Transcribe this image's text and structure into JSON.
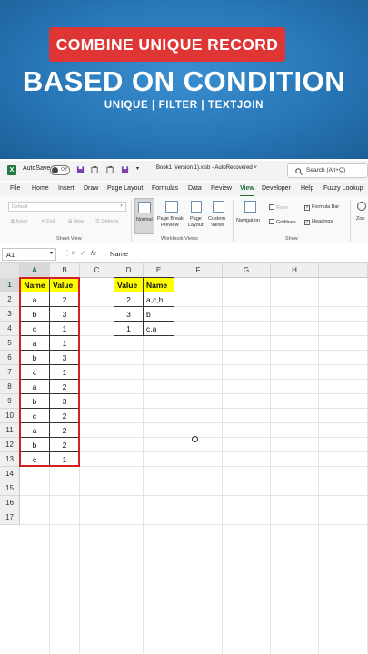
{
  "banner": {
    "pill_text": "COMBINE UNIQUE RECORD",
    "title": "BASED ON CONDITION",
    "subtitle": "UNIQUE | FILTER | TEXTJOIN",
    "colors": {
      "pill": "#e03535",
      "background": "#2877b8"
    }
  },
  "titlebar": {
    "autosave_label": "AutoSave",
    "autosave_state": "Off",
    "filename": "Book1 (version 1).xlsb  -  AutoRecovered",
    "chevron": "˅",
    "search_placeholder": "Search (Alt+Q)"
  },
  "tabs": [
    "File",
    "Home",
    "Insert",
    "Draw",
    "Page Layout",
    "Formulas",
    "Data",
    "Review",
    "View",
    "Developer",
    "Help",
    "Fuzzy Lookup"
  ],
  "active_tab": "View",
  "ribbon": {
    "sheet_view": {
      "dropdown": "Default",
      "keep": "Keep",
      "exit": "Exit",
      "new": "New",
      "options": "Options",
      "label": "Sheet View"
    },
    "workbook_views": {
      "normal": "Normal",
      "page_break_1": "Page Break",
      "page_break_2": "Preview",
      "page_layout_1": "Page",
      "page_layout_2": "Layout",
      "custom_1": "Custom",
      "custom_2": "Views",
      "label": "Workbook Views"
    },
    "show": {
      "navigation": "Navigation",
      "ruler": "Ruler",
      "gridlines": "Gridlines",
      "formula_bar": "Formula Bar",
      "headings": "Headings",
      "label": "Show"
    },
    "zoom_partial": "Zoo"
  },
  "formula_bar": {
    "name_box": "A1",
    "fx": "fx",
    "content": "Name"
  },
  "columns": [
    "A",
    "B",
    "C",
    "D",
    "E",
    "F",
    "G",
    "H",
    "I"
  ],
  "rows": [
    "1",
    "2",
    "3",
    "4",
    "5",
    "6",
    "7",
    "8",
    "9",
    "10",
    "11",
    "12",
    "13",
    "14",
    "15",
    "16",
    "17"
  ],
  "source_table": {
    "headers": [
      "Name",
      "Value"
    ],
    "rows": [
      [
        "a",
        "2"
      ],
      [
        "b",
        "3"
      ],
      [
        "c",
        "1"
      ],
      [
        "a",
        "1"
      ],
      [
        "b",
        "3"
      ],
      [
        "c",
        "1"
      ],
      [
        "a",
        "2"
      ],
      [
        "b",
        "3"
      ],
      [
        "c",
        "2"
      ],
      [
        "a",
        "2"
      ],
      [
        "b",
        "2"
      ],
      [
        "c",
        "1"
      ]
    ]
  },
  "result_table": {
    "headers": [
      "Value",
      "Name"
    ],
    "rows": [
      [
        "2",
        "a,c,b"
      ],
      [
        "3",
        "b"
      ],
      [
        "1",
        "c,a"
      ]
    ]
  },
  "highlight_color": "#ffff00",
  "outline_color": "#d42020"
}
